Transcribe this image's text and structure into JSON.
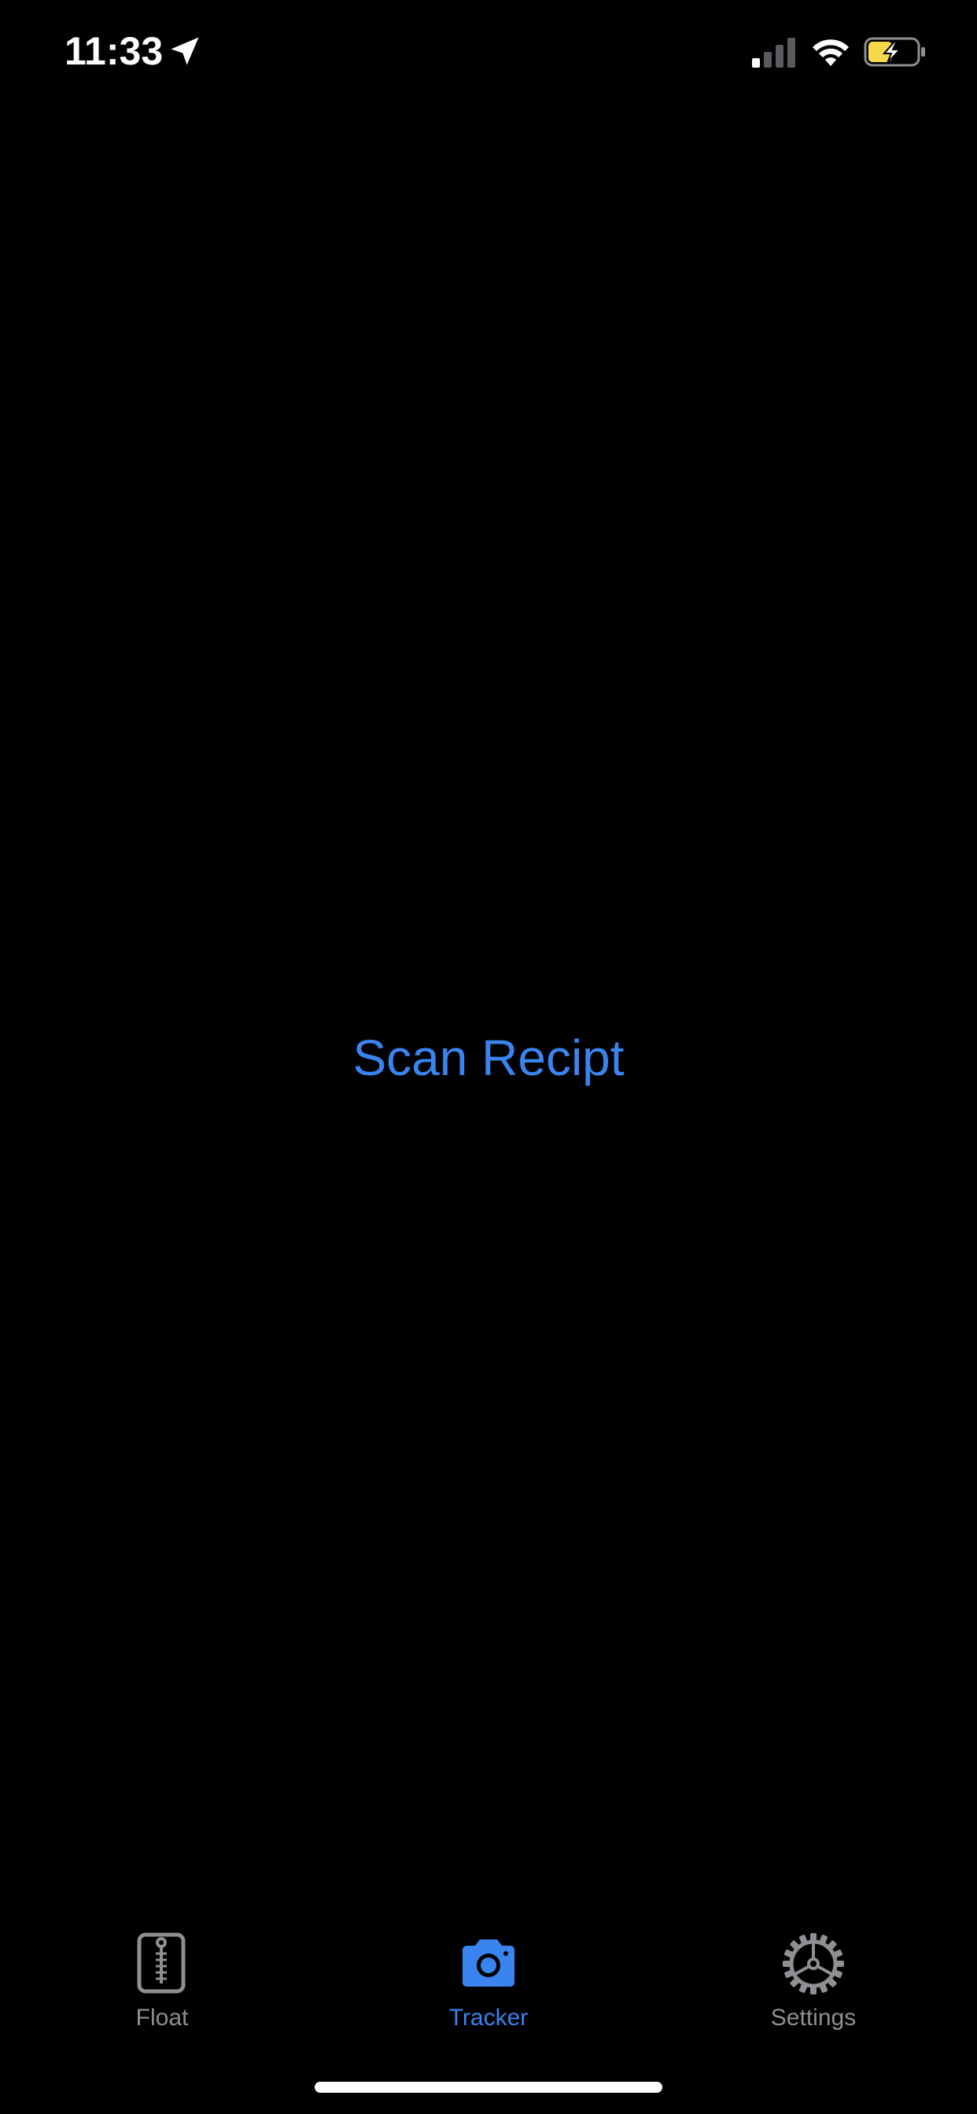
{
  "status_bar": {
    "time": "11:33",
    "icons": [
      "location-arrow-icon",
      "cellular-signal-icon",
      "wifi-icon",
      "battery-charging-icon"
    ]
  },
  "main": {
    "scan_button_label": "Scan Recipt"
  },
  "tab_bar": {
    "active": "Tracker",
    "tabs": [
      {
        "label": "Float",
        "icon": "zipper-document-icon"
      },
      {
        "label": "Tracker",
        "icon": "camera-icon"
      },
      {
        "label": "Settings",
        "icon": "gear-icon"
      }
    ]
  },
  "colors": {
    "background": "#000000",
    "accent": "#3a84f0",
    "inactive": "#8e8e93",
    "battery_fill": "#f7d84a"
  }
}
